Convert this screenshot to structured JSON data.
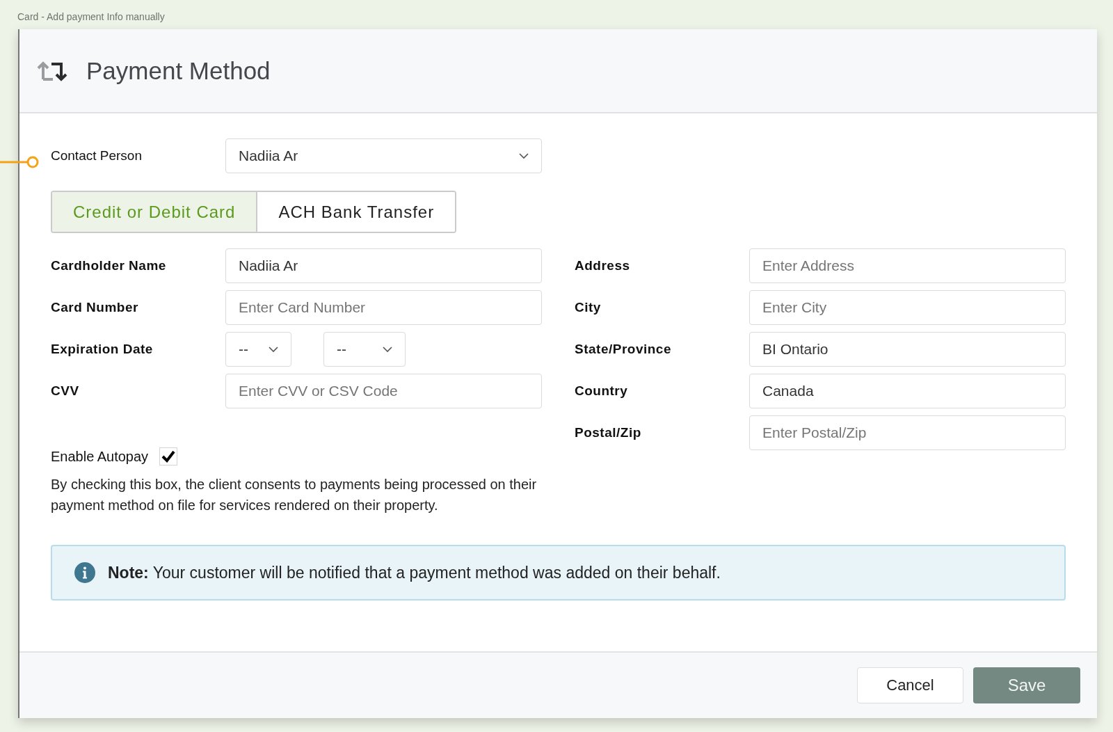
{
  "caption": "Card - Add payment Info manually",
  "dialog": {
    "title": "Payment Method"
  },
  "contact": {
    "label": "Contact Person",
    "value": "Nadiia Ar"
  },
  "tabs": [
    {
      "label": "Credit or Debit Card",
      "selected": true
    },
    {
      "label": "ACH Bank Transfer",
      "selected": false
    }
  ],
  "left_fields": [
    {
      "label": "Cardholder Name",
      "kind": "text",
      "value": "Nadiia Ar"
    },
    {
      "label": "Card Number",
      "kind": "text",
      "placeholder": "Enter Card Number"
    },
    {
      "label": "Expiration Date",
      "kind": "selects",
      "selects": [
        "--",
        "--"
      ]
    },
    {
      "label": "CVV",
      "kind": "text",
      "placeholder": "Enter CVV or CSV Code"
    }
  ],
  "right_fields": [
    {
      "label": "Address",
      "kind": "text",
      "placeholder": "Enter Address"
    },
    {
      "label": "City",
      "kind": "text",
      "placeholder": "Enter City"
    },
    {
      "label": "State/Province",
      "kind": "text",
      "value": "BI Ontario"
    },
    {
      "label": "Country",
      "kind": "text",
      "value": "Canada"
    },
    {
      "label": "Postal/Zip",
      "kind": "text",
      "placeholder": "Enter Postal/Zip"
    }
  ],
  "autopay": {
    "label": "Enable Autopay",
    "checked": true,
    "description": "By checking this box, the client consents to payments being processed on their payment method on file for services rendered on their property."
  },
  "note": "**Note:** Your customer will be notified that a payment method was added on their behalf.",
  "buttons": [
    {
      "label": "Cancel",
      "kind": "secondary"
    },
    {
      "label": "Save",
      "kind": "primary"
    }
  ]
}
